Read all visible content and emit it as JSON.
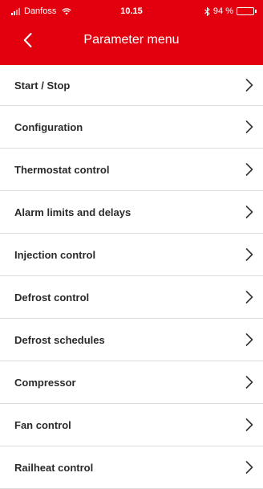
{
  "status_bar": {
    "carrier": "Danfoss",
    "time": "10.15",
    "battery": "94 %",
    "battery_level": 0.94
  },
  "header": {
    "title": "Parameter menu",
    "background": "#e2000f"
  },
  "menu": {
    "items": [
      {
        "label": "Start / Stop"
      },
      {
        "label": "Configuration"
      },
      {
        "label": "Thermostat control"
      },
      {
        "label": "Alarm limits and delays"
      },
      {
        "label": "Injection control"
      },
      {
        "label": "Defrost control"
      },
      {
        "label": "Defrost schedules"
      },
      {
        "label": "Compressor"
      },
      {
        "label": "Fan control"
      },
      {
        "label": "Railheat control"
      }
    ]
  },
  "icons": {
    "back": "chevron-left-icon",
    "item_arrow": "chevron-right-icon"
  }
}
